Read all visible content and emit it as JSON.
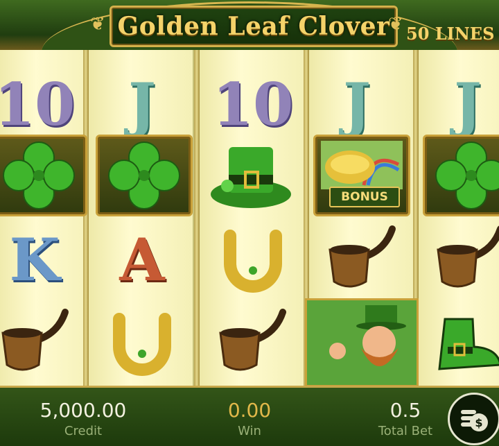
{
  "header": {
    "title": "Golden Leaf Clover",
    "lines_label": "50 LINES"
  },
  "reels": [
    [
      "10",
      "clover",
      "K",
      "pipe"
    ],
    [
      "J",
      "clover",
      "A",
      "horseshoe"
    ],
    [
      "10",
      "leprechaun-hat",
      "horseshoe",
      "pipe"
    ],
    [
      "J",
      "bonus",
      "pipe",
      "leprechaun"
    ],
    [
      "J",
      "clover",
      "pipe",
      "leprechaun-boot"
    ]
  ],
  "bonus_label": "BONUS",
  "footer": {
    "credit_value": "5,000.00",
    "credit_label": "Credit",
    "win_value": "0.00",
    "win_label": "Win",
    "total_bet_value": "0.5",
    "total_bet_label": "Total Bet",
    "bet_button_icon": "coins-icon"
  },
  "colors": {
    "gold": "#f4d36a",
    "deep_green": "#1d3a12",
    "reel_bg": "#fffbd0",
    "credit_color": "#f3f1e0",
    "win_color": "#e1b84a"
  }
}
